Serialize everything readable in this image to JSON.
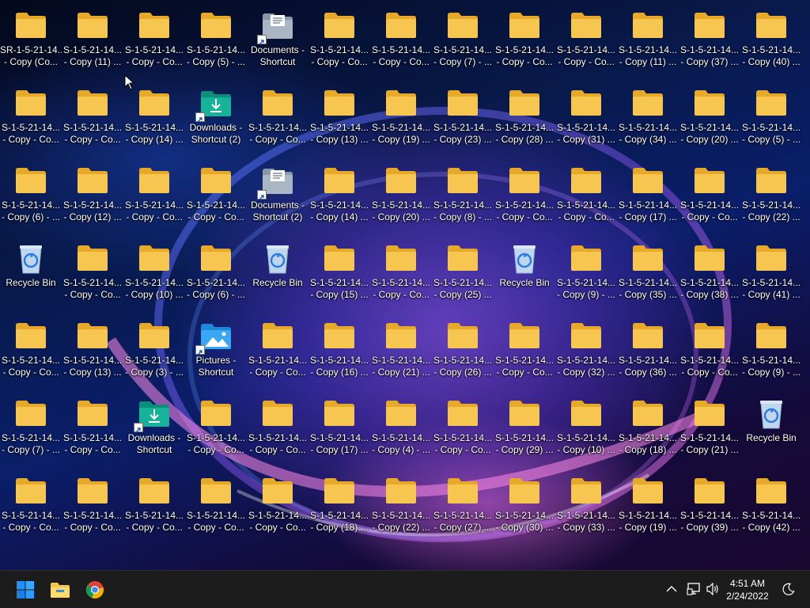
{
  "desktop": {
    "columns": [
      [
        "SR-1-5-21-14...|- Copy (Co...",
        "S-1-5-21-14...|- Copy - Co...",
        "S-1-5-21-14...|- Copy (6) - ...",
        "Recycle Bin",
        "S-1-5-21-14...|- Copy - Co...",
        "S-1-5-21-14...|- Copy (7) - ...",
        "S-1-5-21-14...|- Copy - Co..."
      ],
      [
        "S-1-5-21-14...|- Copy (11) ...",
        "S-1-5-21-14...|- Copy - Co...",
        "S-1-5-21-14...|- Copy (12) ...",
        "S-1-5-21-14...|- Copy - Co...",
        "S-1-5-21-14...|- Copy (13) ...",
        "S-1-5-21-14...|- Copy - Co...",
        "S-1-5-21-14...|- Copy - Co..."
      ],
      [
        "S-1-5-21-14...|- Copy - Co...",
        "S-1-5-21-14...|- Copy (14) ...",
        "S-1-5-21-14...|- Copy - Co...",
        "S-1-5-21-14...|- Copy (10) ...",
        "S-1-5-21-14...|- Copy (3) - ...",
        "Downloads -|Shortcut",
        "S-1-5-21-14...|- Copy - Co..."
      ],
      [
        "S-1-5-21-14...|- Copy (5) - ...",
        "Downloads -|Shortcut (2)",
        "S-1-5-21-14...|- Copy - Co...",
        "S-1-5-21-14...|- Copy (6) - ...",
        "Pictures -|Shortcut",
        "S-1-5-21-14...|- Copy - Co...",
        "S-1-5-21-14...|- Copy - Co..."
      ],
      [
        "Documents -|Shortcut",
        "S-1-5-21-14...|- Copy - Co...",
        "Documents -|Shortcut (2)",
        "Recycle Bin",
        "S-1-5-21-14...|- Copy - Co...",
        "S-1-5-21-14...|- Copy - Co...",
        "S-1-5-21-14...|- Copy - Co..."
      ],
      [
        "S-1-5-21-14...|- Copy - Co...",
        "S-1-5-21-14...|- Copy (13) ...",
        "S-1-5-21-14...|- Copy (14) ...",
        "S-1-5-21-14...|- Copy (15) ...",
        "S-1-5-21-14...|- Copy (16) ...",
        "S-1-5-21-14...|- Copy (17) ...",
        "S-1-5-21-14...|- Copy (18) ..."
      ],
      [
        "S-1-5-21-14...|- Copy - Co...",
        "S-1-5-21-14...|- Copy (19) ...",
        "S-1-5-21-14...|- Copy (20) ...",
        "S-1-5-21-14...|- Copy - Co...",
        "S-1-5-21-14...|- Copy (21) ...",
        "S-1-5-21-14...|- Copy (4) - ...",
        "S-1-5-21-14...|- Copy (22) ..."
      ],
      [
        "S-1-5-21-14...|- Copy (7) - ...",
        "S-1-5-21-14...|- Copy (23) ...",
        "S-1-5-21-14...|- Copy (8) - ...",
        "S-1-5-21-14...|- Copy (25) ...",
        "S-1-5-21-14...|- Copy (26) ...",
        "S-1-5-21-14...|- Copy - Co...",
        "S-1-5-21-14...|- Copy (27) ..."
      ],
      [
        "S-1-5-21-14...|- Copy - Co...",
        "S-1-5-21-14...|- Copy (28) ...",
        "S-1-5-21-14...|- Copy - Co...",
        "Recycle Bin",
        "S-1-5-21-14...|- Copy - Co...",
        "S-1-5-21-14...|- Copy (29) ...",
        "S-1-5-21-14...|- Copy (30) ..."
      ],
      [
        "S-1-5-21-14...|- Copy - Co...",
        "S-1-5-21-14...|- Copy (31) ...",
        "S-1-5-21-14...|- Copy - Co...",
        "S-1-5-21-14...|- Copy (9) - ...",
        "S-1-5-21-14...|- Copy (32) ...",
        "S-1-5-21-14...|- Copy (10) ...",
        "S-1-5-21-14...|- Copy (33) ..."
      ],
      [
        "S-1-5-21-14...|- Copy (11) ...",
        "S-1-5-21-14...|- Copy (34) ...",
        "S-1-5-21-14...|- Copy (17) ...",
        "S-1-5-21-14...|- Copy (35) ...",
        "S-1-5-21-14...|- Copy (36) ...",
        "S-1-5-21-14...|- Copy (18) ...",
        "S-1-5-21-14...|- Copy (19) ..."
      ],
      [
        "S-1-5-21-14...|- Copy (37) ...",
        "S-1-5-21-14...|- Copy (20) ...",
        "S-1-5-21-14...|- Copy - Co...",
        "S-1-5-21-14...|- Copy (38) ...",
        "S-1-5-21-14...|- Copy - Co...",
        "S-1-5-21-14...|- Copy (21) ...",
        "S-1-5-21-14...|- Copy (39) ..."
      ],
      [
        "S-1-5-21-14...|- Copy (40) ...",
        "S-1-5-21-14...|- Copy (5) - ...",
        "S-1-5-21-14...|- Copy (22) ...",
        "S-1-5-21-14...|- Copy (41) ...",
        "S-1-5-21-14...|- Copy (9) - ...",
        "Recycle Bin",
        "S-1-5-21-14...|- Copy (42) ..."
      ]
    ],
    "icon_types": {
      "Recycle Bin": "recycle-bin-icon",
      "Documents -|Shortcut": "documents-shortcut-icon",
      "Documents -|Shortcut (2)": "documents-shortcut-icon",
      "Downloads -|Shortcut": "downloads-shortcut-icon",
      "Downloads -|Shortcut (2)": "downloads-shortcut-icon",
      "Pictures -|Shortcut": "pictures-shortcut-icon"
    }
  },
  "taskbar": {
    "time": "4:51 AM",
    "date": "2/24/2022",
    "pinned": [
      "start-icon",
      "file-explorer-icon",
      "chrome-icon"
    ],
    "tray": [
      "chevron-up-icon",
      "network-icon",
      "volume-icon",
      "moon-icon"
    ]
  },
  "colors": {
    "folder": "#f6c650",
    "folder_dark": "#e6a92a",
    "taskbar": "#1c1c1c",
    "accent": "#0078d4"
  }
}
